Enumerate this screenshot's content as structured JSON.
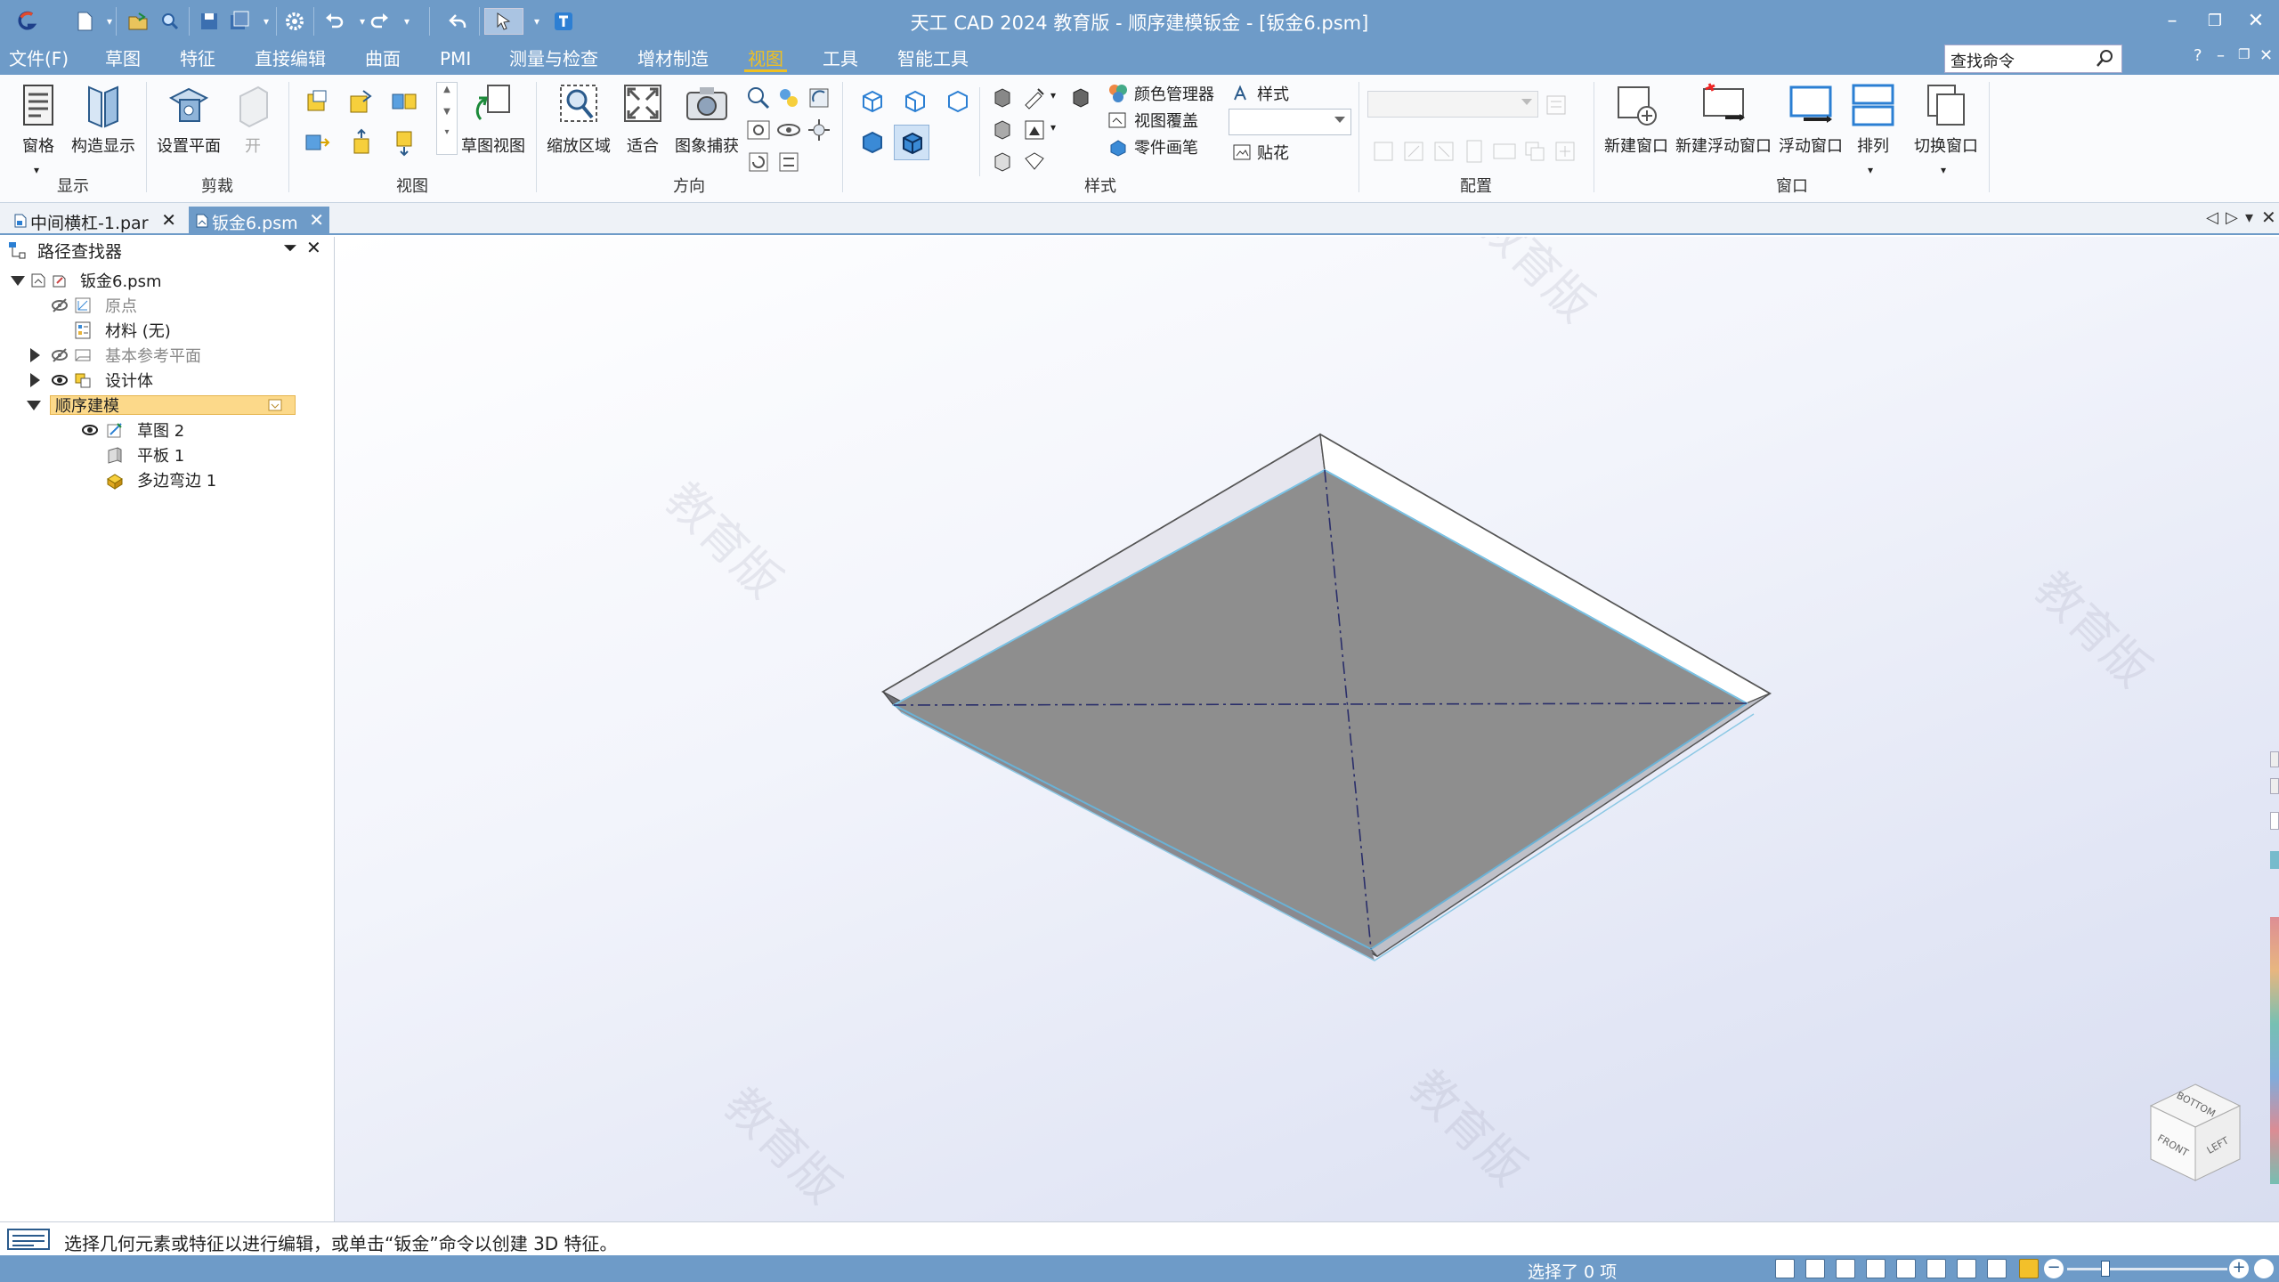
{
  "window": {
    "title": "天工 CAD 2024 教育版 - 顺序建模钣金 - [钣金6.psm]",
    "minimize_icon": "minimize-icon",
    "restore_icon": "restore-icon",
    "close_icon": "close-icon"
  },
  "menu": {
    "items": [
      "文件(F)",
      "草图",
      "特征",
      "直接编辑",
      "曲面",
      "PMI",
      "测量与检查",
      "增材制造",
      "视图",
      "工具",
      "智能工具"
    ],
    "active": "视图",
    "search_placeholder": "查找命令",
    "help": "?"
  },
  "ribbon": {
    "groups": {
      "display": "显示",
      "clip": "剪裁",
      "views": "视图",
      "orient": "方向",
      "style": "样式",
      "config": "配置",
      "window": "窗口"
    },
    "buttons": {
      "pane": "窗格",
      "construct_display": "构造显示",
      "set_plane": "设置平面",
      "open": "开",
      "sketch_view": "草图视图",
      "zoom_area": "缩放区域",
      "fit": "适合",
      "image_capture": "图象捕获",
      "color_manager": "颜色管理器",
      "view_overlay": "视图覆盖",
      "part_painter": "零件画笔",
      "style": "样式",
      "decal": "贴花",
      "new_window": "新建窗口",
      "new_float_window": "新建浮动窗口",
      "float_window": "浮动窗口",
      "arrange": "排列",
      "switch_window": "切换窗口"
    }
  },
  "tabs": [
    {
      "label": "中间横杠-1.par",
      "active": false
    },
    {
      "label": "钣金6.psm",
      "active": true
    }
  ],
  "pathfinder": {
    "title": "路径查找器",
    "items": [
      {
        "label": "钣金6.psm",
        "level": 0,
        "expand": "down",
        "icon": "sheetmetal-part-icon",
        "dim": false
      },
      {
        "label": "原点",
        "level": 1,
        "expand": "",
        "icon": "origin-icon",
        "dim": true
      },
      {
        "label": "材料 (无)",
        "level": 1,
        "expand": "",
        "icon": "material-icon",
        "dim": false
      },
      {
        "label": "基本参考平面",
        "level": 1,
        "expand": "right",
        "icon": "reference-plane-icon",
        "dim": true
      },
      {
        "label": "设计体",
        "level": 1,
        "expand": "right",
        "icon": "design-body-icon",
        "dim": false
      },
      {
        "label": "顺序建模",
        "level": 0,
        "expand": "down",
        "icon": "",
        "dim": false,
        "highlight": true
      },
      {
        "label": "草图 2",
        "level": 2,
        "expand": "",
        "icon": "sketch-icon",
        "dim": false
      },
      {
        "label": "平板 1",
        "level": 2,
        "expand": "",
        "icon": "tab-icon",
        "dim": false
      },
      {
        "label": "多边弯边 1",
        "level": 2,
        "expand": "",
        "icon": "contour-flange-icon",
        "dim": false
      }
    ]
  },
  "viewport": {
    "watermark": "教育版",
    "view_cube": {
      "top": "BOTTOM",
      "front": "FRONT",
      "left": "LEFT"
    }
  },
  "status": {
    "prompt": "选择几何元素或特征以进行编辑，或单击“钣金”命令以创建 3D 特征。",
    "selection": "选择了 0 项"
  }
}
